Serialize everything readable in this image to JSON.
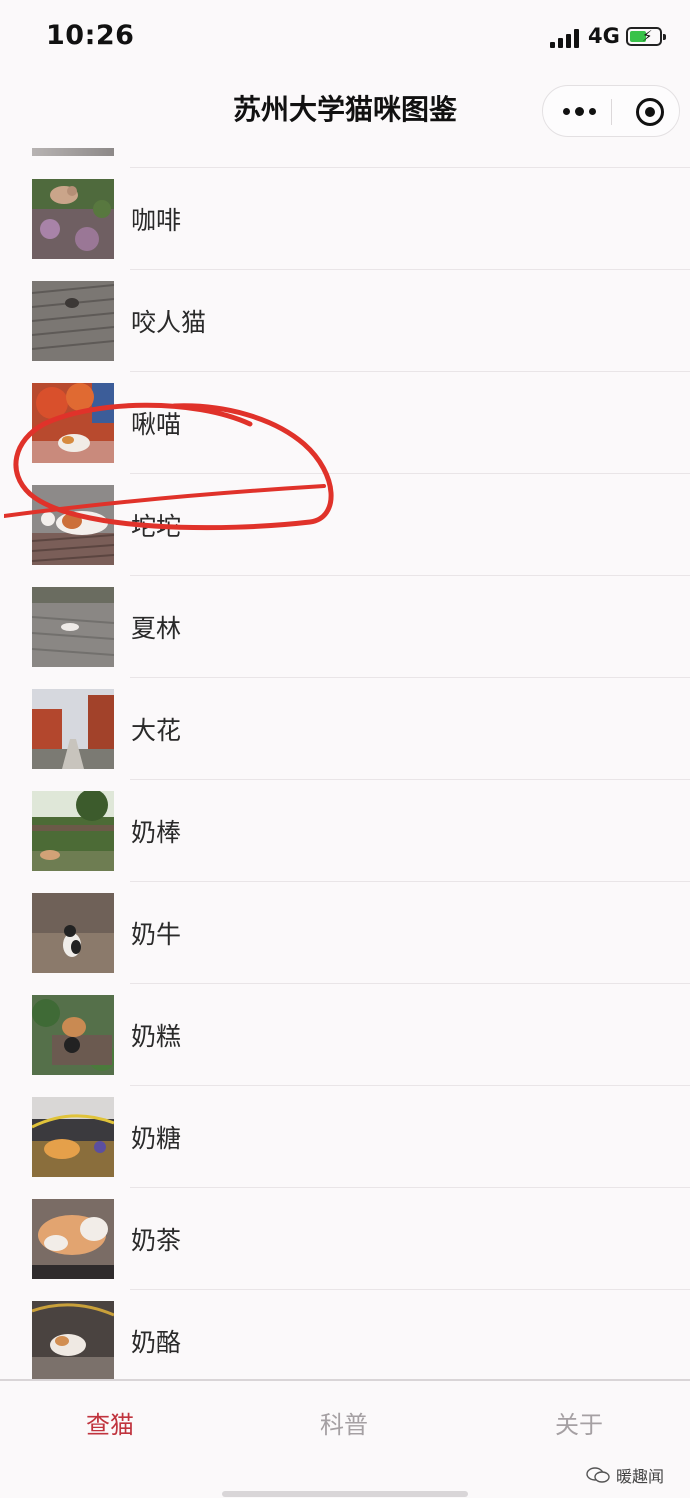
{
  "status_bar": {
    "time": "10:26",
    "network": "4G"
  },
  "nav": {
    "title": "苏州大学猫咪图鉴"
  },
  "cats": [
    {
      "name": "咖啡",
      "thumb": "cat-in-flowers-photo"
    },
    {
      "name": "咬人猫",
      "thumb": "cat-on-wooden-deck-photo"
    },
    {
      "name": "啾喵",
      "thumb": "calico-under-red-tree-photo"
    },
    {
      "name": "坨坨",
      "thumb": "cat-lying-on-roof-photo"
    },
    {
      "name": "夏林",
      "thumb": "cat-on-boardwalk-photo"
    },
    {
      "name": "大花",
      "thumb": "autumn-avenue-photo"
    },
    {
      "name": "奶棒",
      "thumb": "cat-in-park-photo"
    },
    {
      "name": "奶牛",
      "thumb": "black-white-cat-photo"
    },
    {
      "name": "奶糕",
      "thumb": "cat-in-garden-photo"
    },
    {
      "name": "奶糖",
      "thumb": "cat-under-bike-photo"
    },
    {
      "name": "奶茶",
      "thumb": "cat-sleeping-photo"
    },
    {
      "name": "奶酪",
      "thumb": "cat-in-shade-photo"
    }
  ],
  "tabs": [
    {
      "label": "查猫",
      "active": true
    },
    {
      "label": "科普",
      "active": false
    },
    {
      "label": "关于",
      "active": false
    }
  ],
  "watermark": {
    "text": "暖趣闻"
  },
  "colors": {
    "accent": "#c0343e",
    "annotation": "#e0322a",
    "background": "#fbf9fa"
  }
}
